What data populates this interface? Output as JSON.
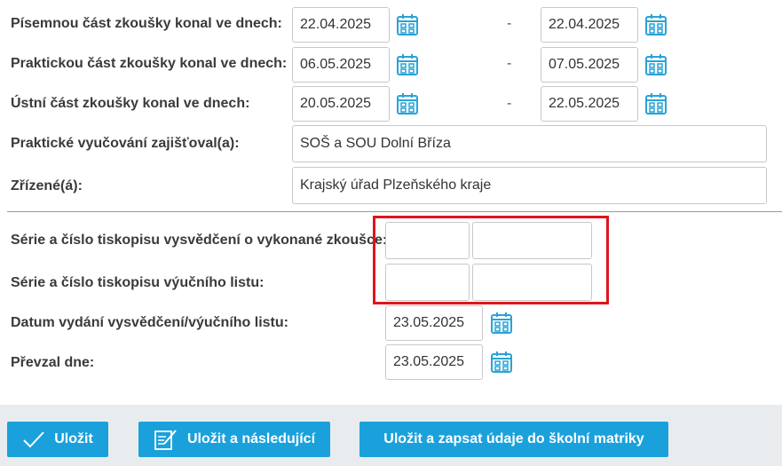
{
  "exam": {
    "written": {
      "label": "Písemnou část zkoušky konal ve dnech:",
      "from": "22.04.2025",
      "to": "22.04.2025"
    },
    "practical": {
      "label": "Praktickou část zkoušky konal ve dnech:",
      "from": "06.05.2025",
      "to": "07.05.2025"
    },
    "oral": {
      "label": "Ústní část zkoušky konal ve dnech:",
      "from": "20.05.2025",
      "to": "22.05.2025"
    },
    "separator": "-"
  },
  "training": {
    "label": "Praktické vyučování zajišťoval(a):",
    "value": "SOŠ a  SOU Dolní Bříza"
  },
  "founder": {
    "label": "Zřízené(á):",
    "value": "Krajský úřad Plzeňského kraje"
  },
  "certificate": {
    "exam_cert_label": "Série a číslo tiskopisu vysvědčení o vykonané zkoušce:",
    "exam_cert_series": "",
    "exam_cert_number": "",
    "appr_cert_label": "Série a číslo tiskopisu výučního listu:",
    "appr_cert_series": "",
    "appr_cert_number": "",
    "issue_date_label": "Datum vydání vysvědčení/výučního listu:",
    "issue_date": "23.05.2025",
    "received_label": "Převzal dne:",
    "received_date": "23.05.2025"
  },
  "buttons": {
    "save": "Uložit",
    "save_next": "Uložit a následující",
    "save_register": "Uložit a zapsat údaje do školní matriky"
  },
  "colors": {
    "accent": "#1aa1dc",
    "highlight": "#e0141e",
    "footer_bg": "#e8ecef"
  }
}
